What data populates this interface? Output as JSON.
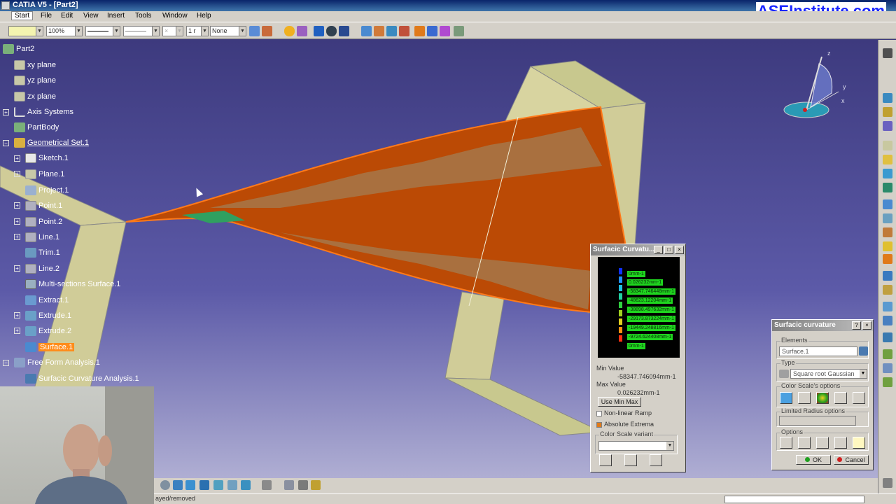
{
  "window": {
    "title": "CATIA V5 - [Part2]",
    "brand": "ASEInstitute.com"
  },
  "menu": [
    "Start",
    "File",
    "Edit",
    "View",
    "Insert",
    "Tools",
    "Window",
    "Help"
  ],
  "toolbar": {
    "zoom": "100%",
    "linetype": "None",
    "width_field": "1 r"
  },
  "tree": [
    {
      "label": "Part2"
    },
    {
      "label": "xy plane"
    },
    {
      "label": "yz plane"
    },
    {
      "label": "zx plane"
    },
    {
      "label": "Axis Systems"
    },
    {
      "label": "PartBody"
    },
    {
      "label": "Geometrical Set.1"
    },
    {
      "label": "Sketch.1"
    },
    {
      "label": "Plane.1"
    },
    {
      "label": "Project.1"
    },
    {
      "label": "Point.1"
    },
    {
      "label": "Point.2"
    },
    {
      "label": "Line.1"
    },
    {
      "label": "Trim.1"
    },
    {
      "label": "Line.2"
    },
    {
      "label": "Multi-sections Surface.1"
    },
    {
      "label": "Extract.1"
    },
    {
      "label": "Extrude.1"
    },
    {
      "label": "Extrude.2"
    },
    {
      "label": "Surface.1"
    },
    {
      "label": "Free Form Analysis.1"
    },
    {
      "label": "Surfacic Curvature Analysis.1"
    }
  ],
  "compass": {
    "z": "z",
    "y": "y",
    "x": "x"
  },
  "scale_dialog": {
    "title": "Surfacic Curvatu...",
    "labels": [
      "0mm-1",
      "0.026232mm-1",
      "-58347.746448mm-1",
      "-48623.12204mm-1",
      "-38898.497632mm-1",
      "-29173.873224mm-1",
      "-19449.248816mm-1",
      "-9724.624408mm-1",
      "0mm-1"
    ],
    "colors": [
      "#1030ff",
      "#2090ff",
      "#20c0e0",
      "#20d0a0",
      "#30d040",
      "#a0d020",
      "#e0d020",
      "#ff9010",
      "#ff3010"
    ],
    "min_label": "Min Value",
    "min_value": "-58347.746094mm-1",
    "max_label": "Max Value",
    "max_value": "0.026232mm-1",
    "use_min_max": "Use Min Max",
    "nonlinear": "Non-linear Ramp",
    "absolute": "Absolute Extrema",
    "variant_label": "Color Scale variant"
  },
  "curv_dialog": {
    "title": "Surfacic curvature",
    "elements_label": "Elements",
    "element": "Surface.1",
    "type_label": "Type",
    "type": "Square root Gaussian",
    "color_scale_label": "Color Scale's options",
    "limited_radius": "Limited Radius options",
    "options_label": "Options",
    "ok": "OK",
    "cancel": "Cancel"
  },
  "status": {
    "text": "ayed/removed"
  }
}
